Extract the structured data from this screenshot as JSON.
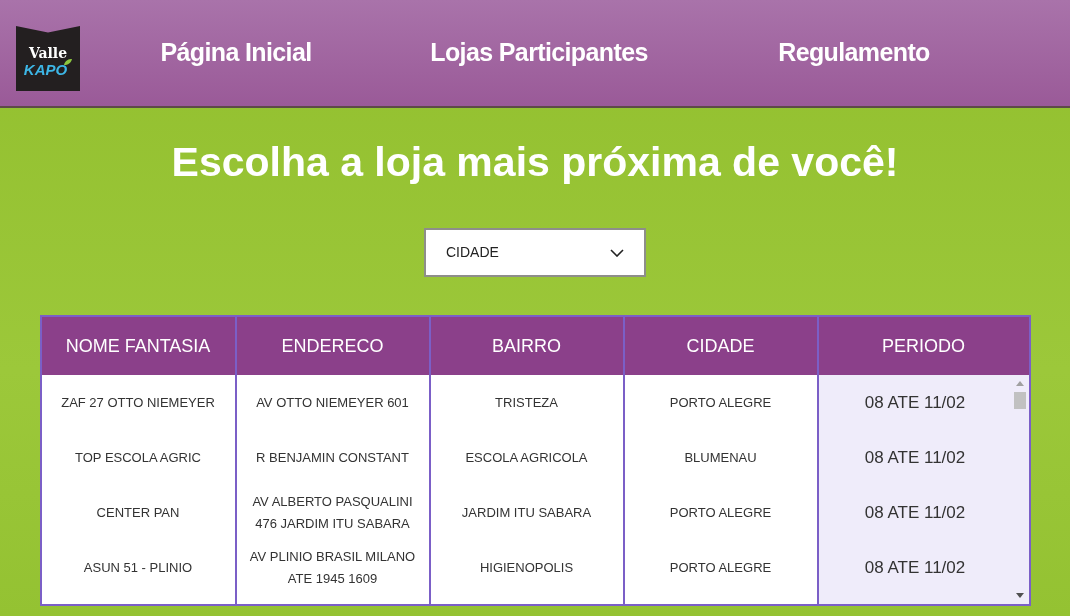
{
  "header": {
    "logo": {
      "brand_line": "Valle",
      "product_line": "KAPO"
    },
    "nav": [
      {
        "label": "Página Inicial"
      },
      {
        "label": "Lojas Participantes"
      },
      {
        "label": "Regulamento"
      }
    ]
  },
  "heading": "Escolha a loja mais próxima de você!",
  "city_filter": {
    "label": "CIDADE"
  },
  "table": {
    "columns": [
      {
        "label": "NOME FANTASIA",
        "highlighted": false
      },
      {
        "label": "ENDERECO",
        "highlighted": false
      },
      {
        "label": "BAIRRO",
        "highlighted": false
      },
      {
        "label": "CIDADE",
        "highlighted": false
      },
      {
        "label": "PERIODO",
        "highlighted": true
      }
    ],
    "rows": [
      [
        "ZAF 27 OTTO NIEMEYER",
        "AV OTTO NIEMEYER 601",
        "TRISTEZA",
        "PORTO ALEGRE",
        "08 ATE 11/02"
      ],
      [
        "TOP ESCOLA AGRIC",
        "R BENJAMIN CONSTANT",
        "ESCOLA AGRICOLA",
        "BLUMENAU",
        "08 ATE 11/02"
      ],
      [
        "CENTER PAN",
        "AV ALBERTO PASQUALINI 476 JARDIM ITU SABARA",
        "JARDIM ITU SABARA",
        "PORTO ALEGRE",
        "08 ATE 11/02"
      ],
      [
        "ASUN 51 - PLINIO",
        "AV PLINIO BRASIL MILANO ATE 1945 1609",
        "HIGIENOPOLIS",
        "PORTO ALEGRE",
        "08 ATE 11/02"
      ]
    ]
  }
}
